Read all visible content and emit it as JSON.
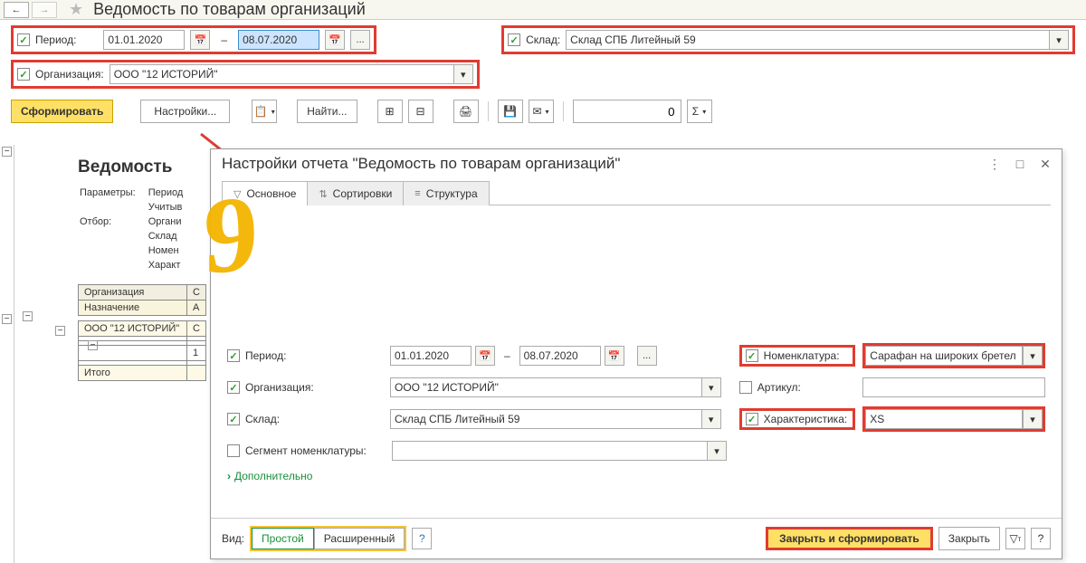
{
  "header": {
    "title": "Ведомость по товарам организаций"
  },
  "filters": {
    "period_label": "Период:",
    "period_from": "01.01.2020",
    "period_to": "08.07.2020",
    "warehouse_label": "Склад:",
    "warehouse_value": "Склад СПБ Литейный 59",
    "org_label": "Организация:",
    "org_value": "ООО \"12 ИСТОРИЙ\""
  },
  "toolbar": {
    "generate": "Сформировать",
    "settings": "Настройки...",
    "find": "Найти...",
    "num_value": "0",
    "sigma": "Σ"
  },
  "report": {
    "title": "Ведомость",
    "params_label": "Параметры:",
    "params_l1": "Период",
    "params_l2": "Учитыв",
    "filter_label": "Отбор:",
    "filter_l1": "Органи",
    "filter_l2": "Склад",
    "filter_l3": "Номен",
    "filter_l4": "Характ",
    "col_org": "Организация",
    "col_s": "С",
    "col_nazn": "Назначение",
    "col_a": "А",
    "row_org": "ООО \"12 ИСТОРИЙ\"",
    "row_sv": "С",
    "row_num": "1",
    "row_total": "Итого"
  },
  "dialog": {
    "title": "Настройки отчета \"Ведомость по товарам организаций\"",
    "tabs": {
      "main": "Основное",
      "sort": "Сортировки",
      "struct": "Структура"
    },
    "period_label": "Период:",
    "period_from": "01.01.2020",
    "period_to": "08.07.2020",
    "org_label": "Организация:",
    "org_value": "ООО \"12 ИСТОРИЙ\"",
    "wh_label": "Склад:",
    "wh_value": "Склад СПБ Литейный 59",
    "seg_label": "Сегмент номенклатуры:",
    "nomen_label": "Номенклатура:",
    "nomen_value": "Сарафан на широких бретел",
    "art_label": "Артикул:",
    "art_value": "",
    "char_label": "Характеристика:",
    "char_value": "XS",
    "more": "Дополнительно",
    "view_label": "Вид:",
    "view_simple": "Простой",
    "view_adv": "Расширенный",
    "close_gen": "Закрыть и сформировать",
    "close": "Закрыть"
  }
}
